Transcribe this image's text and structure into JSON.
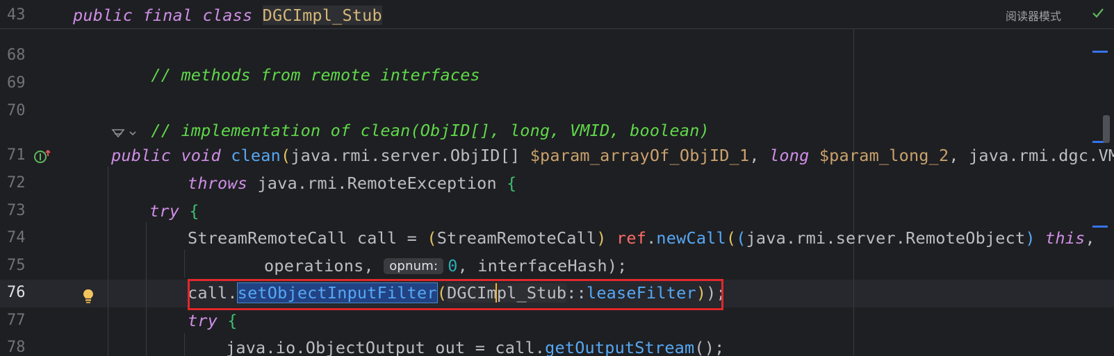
{
  "sticky": {
    "line_number": "43",
    "kw_public": "public",
    "kw_final": "final",
    "kw_class": "class",
    "class_name": "DGCImpl_Stub",
    "reader_mode": "阅读器模式"
  },
  "lines": {
    "n68": "68",
    "n69": "69",
    "n70": "70",
    "n71": "71",
    "n72": "72",
    "n73": "73",
    "n74": "74",
    "n75": "75",
    "n76": "76",
    "n77": "77",
    "n78": "78",
    "c68": "// methods from remote interfaces",
    "c70": "// implementation of clean(ObjID[], long, VMID, boolean)",
    "l71": {
      "kw_public": "public",
      "kw_void": "void",
      "method": "clean",
      "p1_type": "java.rmi.server.ObjID[] ",
      "p1_name": "$param_arrayOf_ObjID_1",
      "comma1": ", ",
      "kw_long": "long",
      "p2_name": "$param_long_2",
      "p3": ", java.rmi.dgc.VMID"
    },
    "l72": {
      "kw_throws": "throws",
      "type": " java.rmi.RemoteException ",
      "brace": "{"
    },
    "l73": {
      "kw_try": "try",
      "brace": "{"
    },
    "l74": {
      "decl": "StreamRemoteCall call = ",
      "cast": "StreamRemoteCall",
      "field_ref": "ref",
      "method": "newCall",
      "cast2": "java.rmi.server.RemoteObject",
      "kw_this": "this",
      "tail": ","
    },
    "l75": {
      "operations": "operations, ",
      "hint": "opnum:",
      "num": "0",
      "tail": ", interfaceHash);"
    },
    "l76": {
      "call": "call.",
      "method": "setObjectInputFilter",
      "arg_class_a": "DGCIm",
      "arg_class_b": "pl_Stub",
      "sep": "::",
      "ref_method": "leaseFilter",
      "tail": ");"
    },
    "l77": {
      "kw_try": "try",
      "brace": "{"
    },
    "l78": {
      "text": "java.io.ObjectOutput out = call.",
      "method": "getOutputStream",
      "tail": "();"
    }
  },
  "colors": {
    "background": "#1e1f22",
    "keyword": "#cf8ee6",
    "comment": "#5fd84a",
    "method": "#56a8f5",
    "highlight_box": "#e0282b"
  },
  "icons": [
    "ai-assist-icon",
    "chevron-down-icon",
    "implementation-icon",
    "lightbulb-icon",
    "check-icon"
  ]
}
